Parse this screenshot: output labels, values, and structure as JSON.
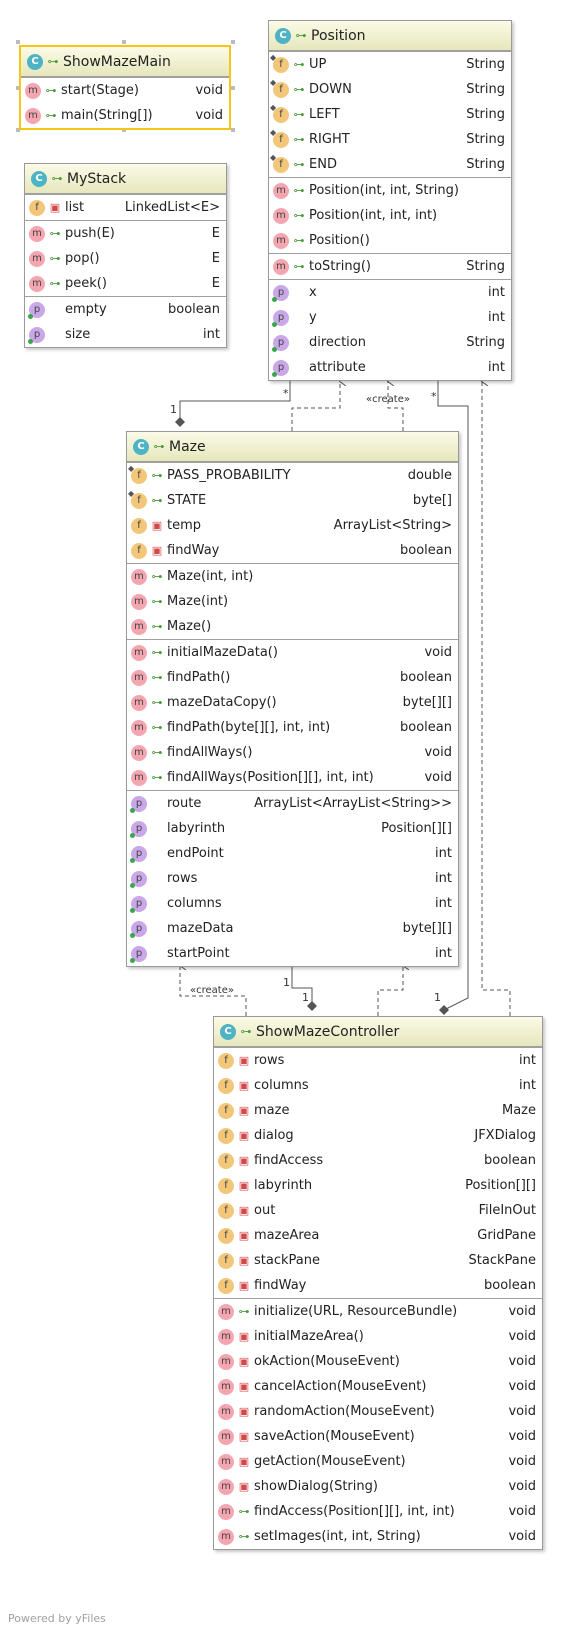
{
  "classes": {
    "show_maze_main": {
      "name": "ShowMazeMain",
      "sections": [
        [
          {
            "kind": "m",
            "vis": "pub",
            "name": "start(Stage)",
            "type": "void"
          },
          {
            "kind": "m",
            "vis": "pub",
            "name": "main(String[])",
            "type": "void"
          }
        ]
      ]
    },
    "my_stack": {
      "name": "MyStack",
      "sections": [
        [
          {
            "kind": "f",
            "vis": "priv",
            "name": "list",
            "type": "LinkedList<E>"
          }
        ],
        [
          {
            "kind": "m",
            "vis": "pub",
            "name": "push(E)",
            "type": "E"
          },
          {
            "kind": "m",
            "vis": "pub",
            "name": "pop()",
            "type": "E"
          },
          {
            "kind": "m",
            "vis": "pub",
            "name": "peek()",
            "type": "E"
          }
        ],
        [
          {
            "kind": "p",
            "vis": "",
            "name": "empty",
            "type": "boolean"
          },
          {
            "kind": "p",
            "vis": "",
            "name": "size",
            "type": "int"
          }
        ]
      ]
    },
    "position": {
      "name": "Position",
      "sections": [
        [
          {
            "kind": "f",
            "vis": "pub",
            "name": "UP",
            "type": "String"
          },
          {
            "kind": "f",
            "vis": "pub",
            "name": "DOWN",
            "type": "String"
          },
          {
            "kind": "f",
            "vis": "pub",
            "name": "LEFT",
            "type": "String"
          },
          {
            "kind": "f",
            "vis": "pub",
            "name": "RIGHT",
            "type": "String"
          },
          {
            "kind": "f",
            "vis": "pub",
            "name": "END",
            "type": "String"
          }
        ],
        [
          {
            "kind": "m",
            "vis": "pub",
            "name": "Position(int, int, String)",
            "type": ""
          },
          {
            "kind": "m",
            "vis": "pub",
            "name": "Position(int, int, int)",
            "type": ""
          },
          {
            "kind": "m",
            "vis": "pub",
            "name": "Position()",
            "type": ""
          }
        ],
        [
          {
            "kind": "m",
            "vis": "pub",
            "name": "toString()",
            "type": "String"
          }
        ],
        [
          {
            "kind": "p",
            "vis": "",
            "name": "x",
            "type": "int"
          },
          {
            "kind": "p",
            "vis": "",
            "name": "y",
            "type": "int"
          },
          {
            "kind": "p",
            "vis": "",
            "name": "direction",
            "type": "String"
          },
          {
            "kind": "p",
            "vis": "",
            "name": "attribute",
            "type": "int"
          }
        ]
      ]
    },
    "maze": {
      "name": "Maze",
      "sections": [
        [
          {
            "kind": "f",
            "vis": "pub",
            "name": "PASS_PROBABILITY",
            "type": "double"
          },
          {
            "kind": "f",
            "vis": "pub",
            "name": "STATE",
            "type": "byte[]"
          },
          {
            "kind": "f",
            "vis": "priv",
            "name": "temp",
            "type": "ArrayList<String>"
          },
          {
            "kind": "f",
            "vis": "priv",
            "name": "findWay",
            "type": "boolean"
          }
        ],
        [
          {
            "kind": "m",
            "vis": "pub",
            "name": "Maze(int, int)",
            "type": ""
          },
          {
            "kind": "m",
            "vis": "pub",
            "name": "Maze(int)",
            "type": ""
          },
          {
            "kind": "m",
            "vis": "pub",
            "name": "Maze()",
            "type": ""
          }
        ],
        [
          {
            "kind": "m",
            "vis": "pub",
            "name": "initialMazeData()",
            "type": "void"
          },
          {
            "kind": "m",
            "vis": "pub",
            "name": "findPath()",
            "type": "boolean"
          },
          {
            "kind": "m",
            "vis": "pub",
            "name": "mazeDataCopy()",
            "type": "byte[][]"
          },
          {
            "kind": "m",
            "vis": "pub",
            "name": "findPath(byte[][], int, int)",
            "type": "boolean"
          },
          {
            "kind": "m",
            "vis": "pub",
            "name": "findAllWays()",
            "type": "void"
          },
          {
            "kind": "m",
            "vis": "pub",
            "name": "findAllWays(Position[][], int, int)",
            "type": "void"
          }
        ],
        [
          {
            "kind": "p",
            "vis": "",
            "name": "route",
            "type": "ArrayList<ArrayList<String>>"
          },
          {
            "kind": "p",
            "vis": "",
            "name": "labyrinth",
            "type": "Position[][]"
          },
          {
            "kind": "p",
            "vis": "",
            "name": "endPoint",
            "type": "int"
          },
          {
            "kind": "p",
            "vis": "",
            "name": "rows",
            "type": "int"
          },
          {
            "kind": "p",
            "vis": "",
            "name": "columns",
            "type": "int"
          },
          {
            "kind": "p",
            "vis": "",
            "name": "mazeData",
            "type": "byte[][]"
          },
          {
            "kind": "p",
            "vis": "",
            "name": "startPoint",
            "type": "int"
          }
        ]
      ]
    },
    "controller": {
      "name": "ShowMazeController",
      "sections": [
        [
          {
            "kind": "f",
            "vis": "priv",
            "name": "rows",
            "type": "int"
          },
          {
            "kind": "f",
            "vis": "priv",
            "name": "columns",
            "type": "int"
          },
          {
            "kind": "f",
            "vis": "priv",
            "name": "maze",
            "type": "Maze"
          },
          {
            "kind": "f",
            "vis": "priv",
            "name": "dialog",
            "type": "JFXDialog"
          },
          {
            "kind": "f",
            "vis": "priv",
            "name": "findAccess",
            "type": "boolean"
          },
          {
            "kind": "f",
            "vis": "priv",
            "name": "labyrinth",
            "type": "Position[][]"
          },
          {
            "kind": "f",
            "vis": "priv",
            "name": "out",
            "type": "FileInOut"
          },
          {
            "kind": "f",
            "vis": "priv",
            "name": "mazeArea",
            "type": "GridPane"
          },
          {
            "kind": "f",
            "vis": "priv",
            "name": "stackPane",
            "type": "StackPane"
          },
          {
            "kind": "f",
            "vis": "priv",
            "name": "findWay",
            "type": "boolean"
          }
        ],
        [
          {
            "kind": "m",
            "vis": "pub",
            "name": "initialize(URL, ResourceBundle)",
            "type": "void"
          },
          {
            "kind": "m",
            "vis": "priv",
            "name": "initialMazeArea()",
            "type": "void"
          },
          {
            "kind": "m",
            "vis": "priv",
            "name": "okAction(MouseEvent)",
            "type": "void"
          },
          {
            "kind": "m",
            "vis": "priv",
            "name": "cancelAction(MouseEvent)",
            "type": "void"
          },
          {
            "kind": "m",
            "vis": "priv",
            "name": "randomAction(MouseEvent)",
            "type": "void"
          },
          {
            "kind": "m",
            "vis": "priv",
            "name": "saveAction(MouseEvent)",
            "type": "void"
          },
          {
            "kind": "m",
            "vis": "priv",
            "name": "getAction(MouseEvent)",
            "type": "void"
          },
          {
            "kind": "m",
            "vis": "priv",
            "name": "showDialog(String)",
            "type": "void"
          },
          {
            "kind": "m",
            "vis": "pub",
            "name": "findAccess(Position[][], int, int)",
            "type": "void"
          },
          {
            "kind": "m",
            "vis": "pub",
            "name": "setImages(int, int, String)",
            "type": "void"
          }
        ]
      ]
    }
  },
  "edge_labels": {
    "create_position": "«create»",
    "create_maze": "«create»",
    "mult_position_maze_many": "*",
    "mult_position_maze_one": "1",
    "mult_position_ctrl_many": "*",
    "mult_maze_ctrl_one_a": "1",
    "mult_maze_ctrl_one_b": "1",
    "mult_ctrl_position_one": "1"
  },
  "icons": {
    "class": "C",
    "method": "m",
    "field": "f",
    "property": "p"
  },
  "colors": {
    "header_top": "#fbfbe8",
    "header_bottom": "#e6e7bc",
    "selection": "#f5c518",
    "edge": "#555555"
  },
  "footer": "Powered by yFiles"
}
